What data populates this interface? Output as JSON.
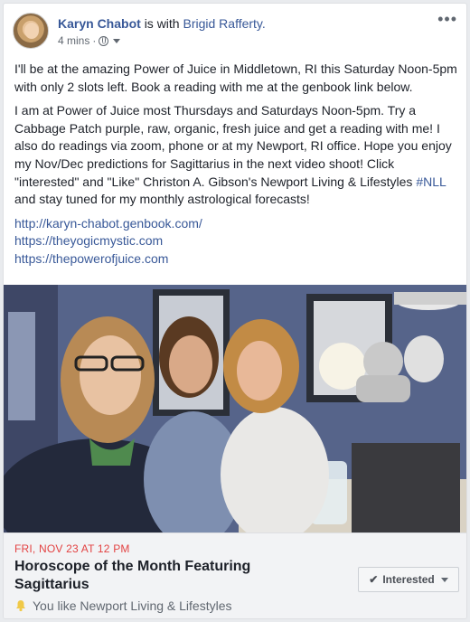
{
  "post": {
    "author": "Karyn Chabot",
    "with_text": "is with",
    "tagged": "Brigid Rafferty.",
    "time": "4 mins",
    "separator": "·",
    "more_icon": "ellipsis-icon",
    "privacy_icon": "globe-icon",
    "paragraph1": "I'll be at the amazing Power of Juice in Middletown, RI this Saturday Noon-5pm with only 2 slots left. Book a reading with me at the genbook link below.",
    "paragraph2_before": "I am at Power of Juice most Thursdays and Saturdays Noon-5pm. Try a Cabbage Patch purple, raw, organic, fresh juice and get a reading with me! I also do readings via zoom, phone or at my Newport, RI office. Hope you enjoy my Nov/Dec predictions for Sagittarius in the next video shoot! Click \"interested\" and \"Like\" Christon A. Gibson's Newport Living & Lifestyles ",
    "hashtag": "#NLL",
    "paragraph2_after": " and stay tuned for my monthly astrological forecasts!",
    "links": [
      "http://karyn-chabot.genbook.com/",
      "https://theyogicmystic.com",
      "https://thepowerofjuice.com"
    ]
  },
  "event": {
    "date": "FRI, NOV 23 AT 12 PM",
    "title": "Horoscope of the Month Featuring Sagittarius",
    "interested_label": "Interested",
    "interested_icon": "check-icon",
    "like_text": "You like Newport Living & Lifestyles",
    "like_icon": "bell-icon"
  },
  "colors": {
    "link": "#385898",
    "event_date": "#e34242",
    "background": "#e9ebee"
  }
}
